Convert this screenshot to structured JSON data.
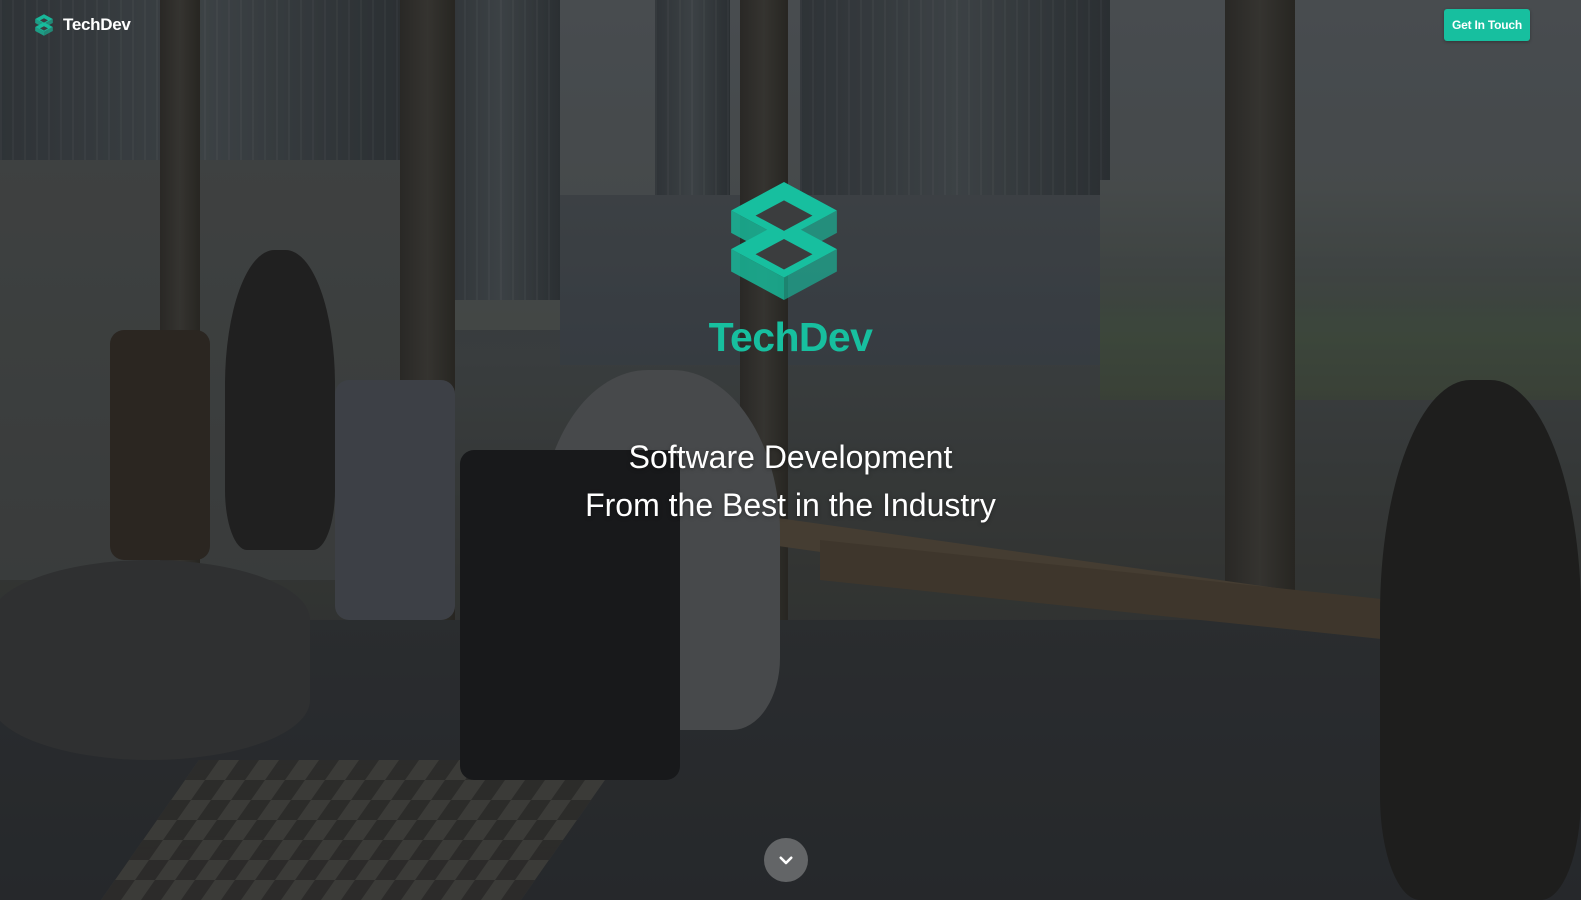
{
  "header": {
    "brand_name": "TechDev",
    "cta_label": "Get In Touch",
    "icons": {
      "brand": "techdev-logo-icon"
    }
  },
  "hero": {
    "brand_name": "TechDev",
    "headline_line1": "Software Development",
    "headline_line2": "From the Best in the Industry",
    "icons": {
      "logo": "techdev-logo-icon",
      "scroll": "chevron-down-icon"
    }
  },
  "theme": {
    "accent": "#17bf9f",
    "text": "#ffffff",
    "scroll_button_bg": "#6e7072"
  }
}
